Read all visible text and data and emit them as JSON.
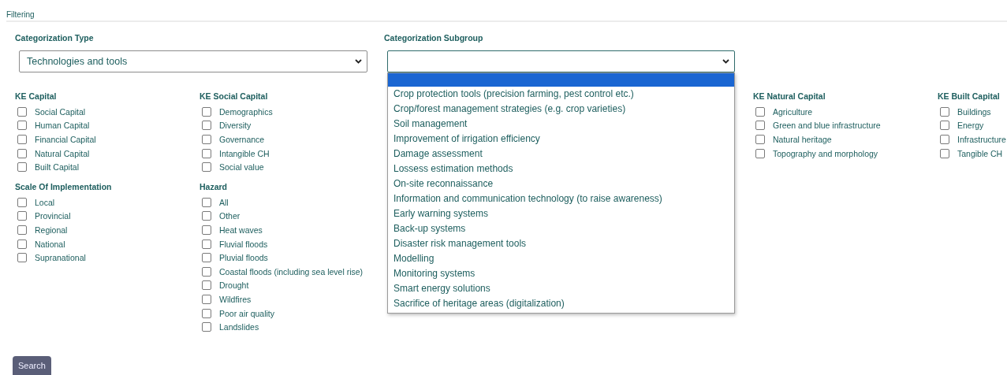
{
  "section_title": "Filtering",
  "selects": [
    {
      "label": "Categorization Type",
      "value": "Technologies and tools",
      "expanded": false
    },
    {
      "label": "Categorization Subgroup",
      "expanded": true,
      "options": [
        {
          "selected": true
        },
        {
          "label": "Crop protection tools (precision farming, pest control etc.)",
          "selected": false
        },
        {
          "label": "Crop/forest management strategies (e.g. crop varieties)",
          "selected": false
        },
        {
          "label": "Soil management",
          "selected": false
        },
        {
          "label": "Improvement of irrigation efficiency",
          "selected": false
        },
        {
          "label": "Damage assessment",
          "selected": false
        },
        {
          "label": "Lossess estimation methods",
          "selected": false
        },
        {
          "label": "On-site reconnaissance",
          "selected": false
        },
        {
          "label": "Information and communication technology (to raise awareness)",
          "selected": false
        },
        {
          "label": "Early warning systems",
          "selected": false
        },
        {
          "label": "Back-up systems",
          "selected": false
        },
        {
          "label": "Disaster risk management tools",
          "selected": false
        },
        {
          "label": "Modelling",
          "selected": false
        },
        {
          "label": "Monitoring systems",
          "selected": false
        },
        {
          "label": "Smart energy solutions",
          "selected": false
        },
        {
          "label": "Sacrifice of heritage areas (digitalization)",
          "selected": false
        }
      ]
    }
  ],
  "columns": [
    {
      "groups": [
        {
          "title": "KE Capital",
          "options": [
            {
              "label": "Social Capital",
              "checked": false
            },
            {
              "label": "Human Capital",
              "checked": false
            },
            {
              "label": "Financial Capital",
              "checked": false
            },
            {
              "label": "Natural Capital",
              "checked": false
            },
            {
              "label": "Built Capital",
              "checked": false
            }
          ]
        },
        {
          "title": "Scale Of Implementation",
          "options": [
            {
              "label": "Local",
              "checked": false
            },
            {
              "label": "Provincial",
              "checked": false
            },
            {
              "label": "Regional",
              "checked": false
            },
            {
              "label": "National",
              "checked": false
            },
            {
              "label": "Supranational",
              "checked": false
            }
          ]
        }
      ]
    },
    {
      "groups": [
        {
          "title": "KE Social Capital",
          "options": [
            {
              "label": "Demographics",
              "checked": false
            },
            {
              "label": "Diversity",
              "checked": false
            },
            {
              "label": "Governance",
              "checked": false
            },
            {
              "label": "Intangible CH",
              "checked": false
            },
            {
              "label": "Social value",
              "checked": false
            }
          ]
        },
        {
          "title": "Hazard",
          "options": [
            {
              "label": "All",
              "checked": false
            },
            {
              "label": "Other",
              "checked": false
            },
            {
              "label": "Heat waves",
              "checked": false
            },
            {
              "label": "Fluvial floods",
              "checked": false
            },
            {
              "label": "Pluvial floods",
              "checked": false
            },
            {
              "label": "Coastal floods (including sea level rise)",
              "checked": false
            },
            {
              "label": "Drought",
              "checked": false
            },
            {
              "label": "Wildfires",
              "checked": false
            },
            {
              "label": "Poor air quality",
              "checked": false
            },
            {
              "label": "Landslides",
              "checked": false
            }
          ]
        }
      ]
    },
    {
      "groups": [
        {
          "title": "KE Natural Capital",
          "options": [
            {
              "label": "Agriculture",
              "checked": false
            },
            {
              "label": "Green and blue infrastructure",
              "checked": false
            },
            {
              "label": "Natural heritage",
              "checked": false
            },
            {
              "label": "Topography and morphology",
              "checked": false
            }
          ]
        }
      ]
    },
    {
      "groups": [
        {
          "title": "KE Built Capital",
          "options": [
            {
              "label": "Buildings",
              "checked": false
            },
            {
              "label": "Energy",
              "checked": false
            },
            {
              "label": "Infrastructure",
              "checked": false
            },
            {
              "label": "Tangible CH",
              "checked": false
            }
          ]
        }
      ]
    }
  ],
  "search_button": "Search"
}
